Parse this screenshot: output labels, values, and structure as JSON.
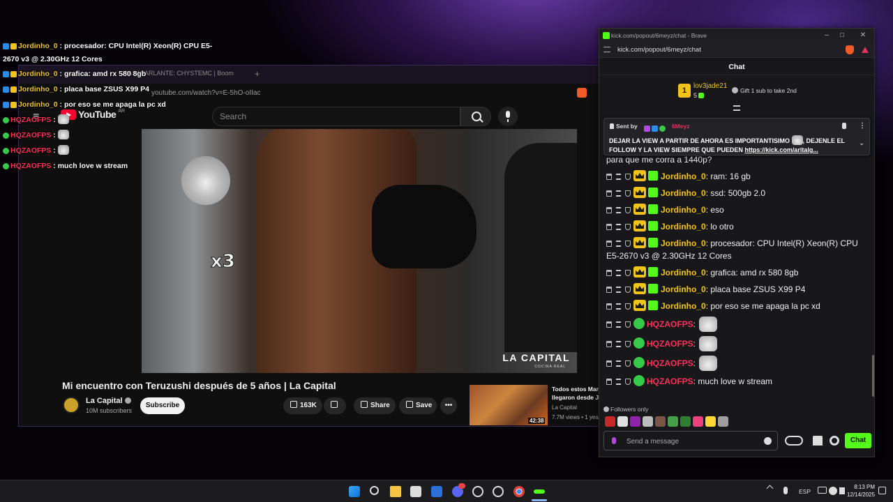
{
  "youtube": {
    "tab_title": "CASAPARLANTE: CHYSTEMC | Boom",
    "url": "youtube.com/watch?v=E-5hO-oIIac",
    "logo_text": "YouTube",
    "logo_region": "AR",
    "search_placeholder": "Search",
    "video_brand": "LA CAPITAL",
    "video_brand_sub": "COCINA REAL",
    "video_title": "Mi encuentro con Teruzushi después de 5 años | La Capital",
    "channel_name": "La Capital",
    "channel_subs": "10M subscribers",
    "subscribe_label": "Subscribe",
    "like_count": "163K",
    "share_label": "Share",
    "save_label": "Save",
    "more_label": "•••",
    "up_next": {
      "title": "Todos estos Mar\nllegaron desde J",
      "channel": "La Capital",
      "meta": "7.7M views • 1 year",
      "duration": "42:38"
    },
    "overlay_multiplier": "x3"
  },
  "overlay_chat": [
    {
      "user": "Jordinho_0",
      "text": "procesador: CPU Intel(R) Xeon(R) CPU E5-2670 v3 @ 2.30GHz 12 Cores",
      "user_color": "gold",
      "wrap": true
    },
    {
      "user": "Jordinho_0",
      "text": "grafica: amd rx 580 8gb",
      "user_color": "gold"
    },
    {
      "user": "Jordinho_0",
      "text": "placa base ZSUS X99 P4",
      "user_color": "gold"
    },
    {
      "user": "Jordinho_0",
      "text": "por eso se me apaga la pc xd",
      "user_color": "gold"
    },
    {
      "user": "HQZAOFPS",
      "text": "",
      "user_color": "red",
      "emote": true
    },
    {
      "user": "HQZAOFPS",
      "text": "",
      "user_color": "red",
      "emote": true
    },
    {
      "user": "HQZAOFPS",
      "text": "",
      "user_color": "red",
      "emote": true
    },
    {
      "user": "HQZAOFPS",
      "text": "much love w stream",
      "user_color": "red"
    }
  ],
  "kick": {
    "window_title": "kick.com/popout/6meyz/chat - Brave",
    "url": "kick.com/popout/6meyz/chat",
    "header": "Chat",
    "leaderboard": {
      "rank": "1",
      "user": "lov3jade21",
      "count": "5",
      "gift_text": "Gift 1 sub to take 2nd"
    },
    "pinned": {
      "sent_by": "Sent by",
      "user": "6Meyz",
      "text": "DEJAR LA VIEW A PARTIR DE AHORA ES IMPORTANTISIMO",
      "text2": ", DEJENLE EL FOLLOW Y LA VIEW SIEMPRE QUE PUEDEN",
      "link": "https://kick.com/aritalg..."
    },
    "partial_top_text": "para que me corra a 1440p?",
    "messages": [
      {
        "user": "Jordinho_0",
        "text": "ram: 16 gb"
      },
      {
        "user": "Jordinho_0",
        "text": "ssd: 500gb 2.0"
      },
      {
        "user": "Jordinho_0",
        "text": "eso"
      },
      {
        "user": "Jordinho_0",
        "text": "lo otro"
      },
      {
        "user": "Jordinho_0",
        "text": "procesador: CPU Intel(R) Xeon(R) CPU E5-2670 v3 @ 2.30GHz 12 Cores"
      },
      {
        "user": "Jordinho_0",
        "text": "grafica: amd rx 580 8gb"
      },
      {
        "user": "Jordinho_0",
        "text": "placa base ZSUS X99 P4"
      },
      {
        "user": "Jordinho_0",
        "text": "por eso se me apaga la pc xd"
      },
      {
        "user": "HQZAOFPS",
        "text": ""
      },
      {
        "user": "HQZAOFPS",
        "text": ""
      },
      {
        "user": "HQZAOFPS",
        "text": ""
      },
      {
        "user": "HQZAOFPS",
        "text": "much love w stream"
      }
    ],
    "followers_only": "Followers only",
    "emote_bar_colors": [
      "#c62828",
      "#e0e0e0",
      "#8e24aa",
      "#bdbdbd",
      "#795548",
      "#43a047",
      "#2e7d32",
      "#ec407a",
      "#fdd835",
      "#9e9e9e"
    ],
    "input_placeholder": "Send a message",
    "chat_button": "Chat"
  },
  "taskbar": {
    "lang": "ESP",
    "time": "8:13 PM",
    "date": "12/14/2025"
  },
  "colors": {
    "kick_green": "#53fc18",
    "user_gold": "#f2c318",
    "user_red": "#ff2f5a"
  }
}
